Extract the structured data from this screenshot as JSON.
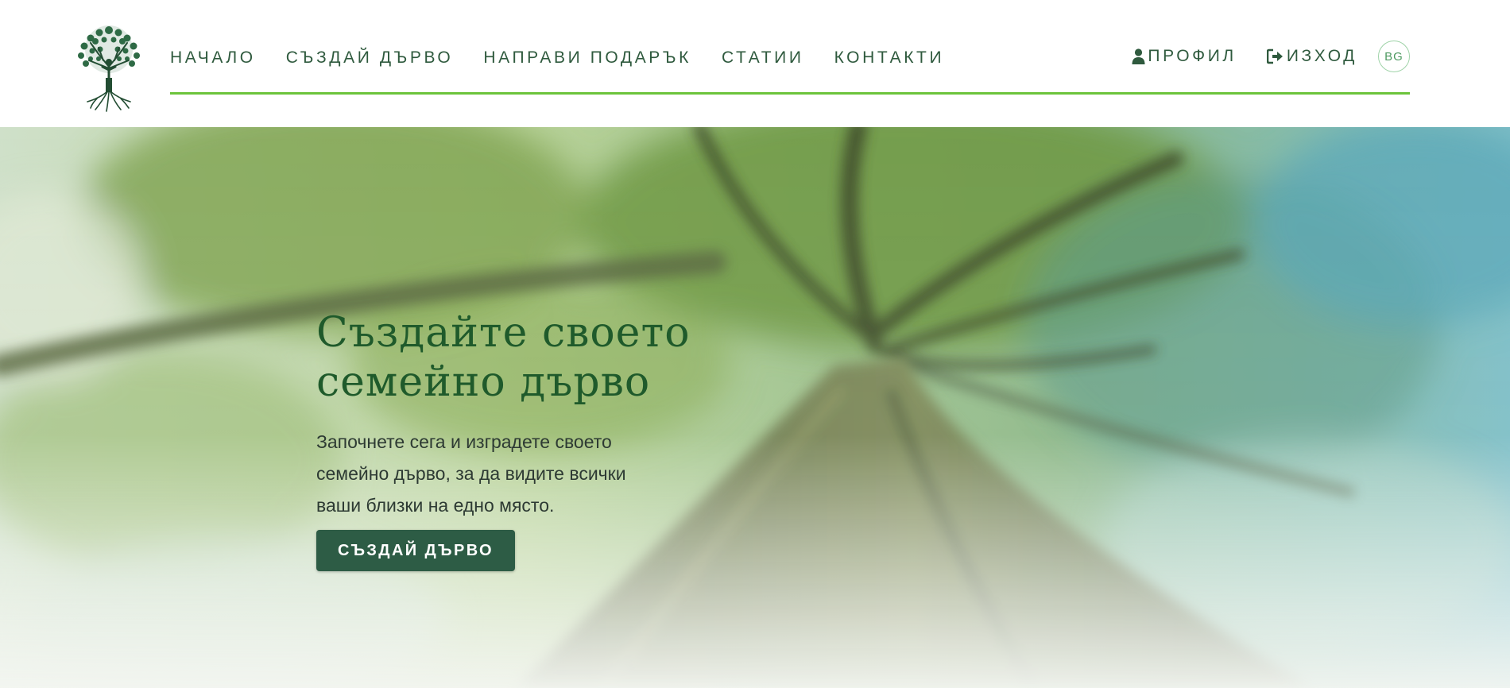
{
  "nav": {
    "items": [
      {
        "label": "НАЧАЛО"
      },
      {
        "label": "СЪЗДАЙ ДЪРВО"
      },
      {
        "label": "НАПРАВИ ПОДАРЪК"
      },
      {
        "label": "СТАТИИ"
      },
      {
        "label": "КОНТАКТИ"
      }
    ]
  },
  "user_nav": {
    "profile_label": "ПРОФИЛ",
    "profile_icon": "user-icon",
    "logout_label": "ИЗХОД",
    "logout_icon": "sign-out-icon",
    "language": "BG"
  },
  "logo": {
    "icon": "tree-logo-icon"
  },
  "hero": {
    "title_line1": "Създайте своето",
    "title_line2": "семейно дърво",
    "text_line1": "Започнете сега и изградете своето",
    "text_line2": "семейно дърво, за да видите всички",
    "text_line3": "ваши близки на едно място.",
    "button_label": "СЪЗДАЙ ДЪРВО"
  },
  "colors": {
    "accent_line": "#6cc43b",
    "nav_text": "#2f5a3e",
    "title": "#1f5a2b",
    "button": "#2d5c45"
  }
}
